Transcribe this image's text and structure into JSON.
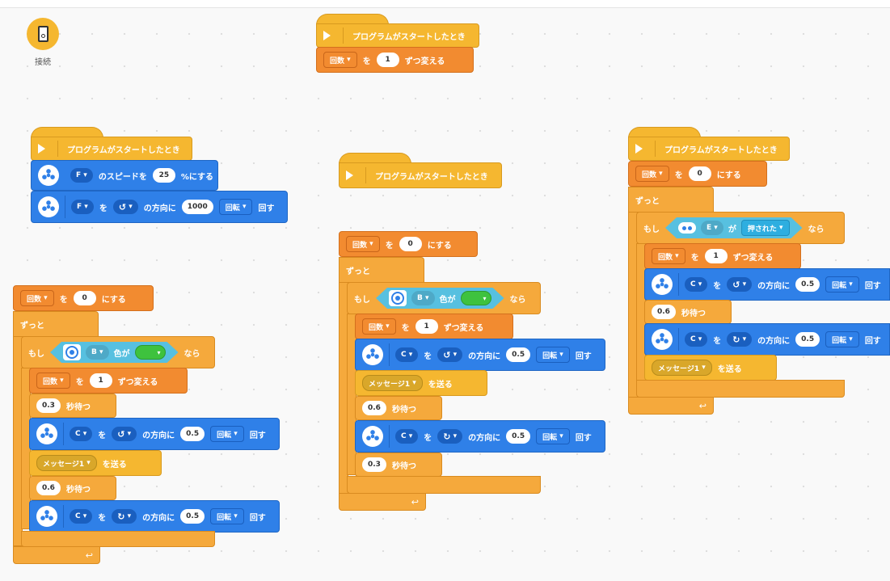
{
  "connect": {
    "label": "接続"
  },
  "common": {
    "when_start": "プログラムがスタートしたとき",
    "counter_var": "回数",
    "op_wo": "を",
    "op_change": "ずつ変える",
    "op_set": "にする",
    "forever": "ずっと",
    "if": "もし",
    "then": "なら",
    "is_color": "色が",
    "ga": "が",
    "dir_suffix": "の方向に",
    "rotations": "回転",
    "run": "回す",
    "wait_sec": "秒待つ",
    "message1": "メッセージ1",
    "send": "を送る",
    "speed_label": "のスピードを",
    "pct_set": "%にする",
    "pressed": "押された",
    "ccw_symbol": "↺",
    "cw_symbol": "↻",
    "dropdown_arrow": "▾",
    "loop_arrow": "↩"
  },
  "ports": {
    "F": "F",
    "B": "B",
    "C": "C",
    "E": "E"
  },
  "values": {
    "one": "1",
    "zero": "0",
    "speed25": "25",
    "n1000": "1000",
    "half": "0.5",
    "wait03": "0.3",
    "wait06": "0.6"
  }
}
